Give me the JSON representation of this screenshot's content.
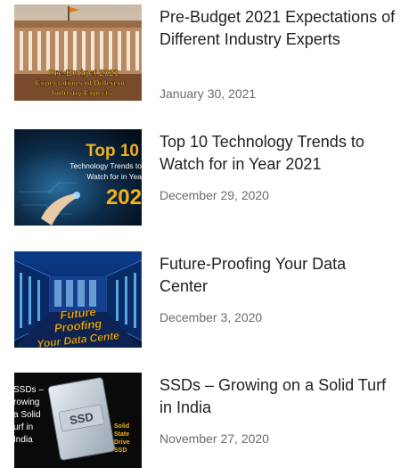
{
  "posts": [
    {
      "title": "Pre-Budget 2021 Expectations of Different Industry Experts",
      "date": "January 30, 2021",
      "thumbnail": {
        "subject": "parliament-building",
        "lines": [
          "Pre-Budget 2021",
          "Expectations of Different",
          "Industry Experts"
        ]
      }
    },
    {
      "title": "Top 10 Technology Trends to Watch for in Year 2021",
      "date": "December 29, 2020",
      "thumbnail": {
        "subject": "technology-trends",
        "headline": "Top 10",
        "lines": [
          "Technology Trends to",
          "Watch for in Yea"
        ],
        "year": "202"
      }
    },
    {
      "title": "Future-Proofing Your Data Center",
      "date": "December 3, 2020",
      "thumbnail": {
        "subject": "data-center",
        "lines": [
          "Future",
          "Proofing",
          "Your Data Cente"
        ]
      }
    },
    {
      "title": "SSDs – Growing on a Solid Turf in India",
      "date": "November 27, 2020",
      "thumbnail": {
        "subject": "ssd-drive",
        "lines": [
          "SSDs –",
          "rowing",
          "a Solid",
          "urf in",
          "India"
        ],
        "drive_label": "SSD",
        "side_lines": [
          "Solid",
          "State",
          "Drive",
          "SSD"
        ]
      }
    }
  ],
  "colors": {
    "title": "#222222",
    "date": "#6b6b6b",
    "accent_gold": "#f2b21c",
    "background": "#ffffff"
  }
}
